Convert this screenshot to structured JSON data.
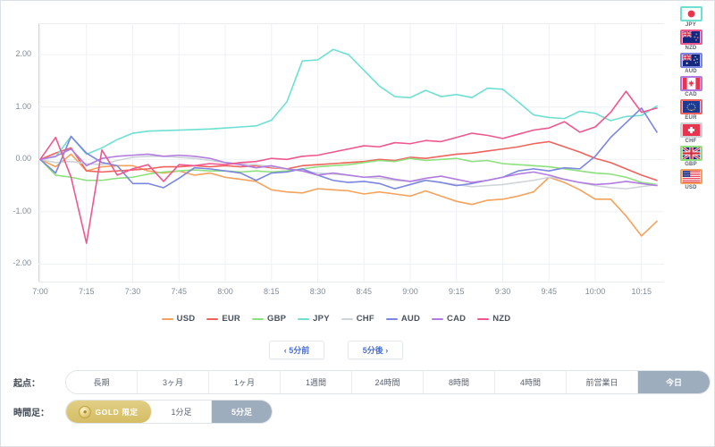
{
  "chart_data": {
    "type": "line",
    "title": "",
    "xlabel": "",
    "ylabel": "",
    "xlim": [
      "7:00",
      "10:20"
    ],
    "ylim": [
      -2.35,
      2.6
    ],
    "yticks": [
      "2.00",
      "1.00",
      "0.00",
      "-1.00",
      "-2.00"
    ],
    "ytick_values": [
      2,
      1,
      0,
      -1,
      -2
    ],
    "xticks": [
      "7:00",
      "7:15",
      "7:30",
      "7:45",
      "8:00",
      "8:15",
      "8:30",
      "8:45",
      "9:00",
      "9:15",
      "9:30",
      "9:45",
      "10:00",
      "10:15"
    ],
    "grid": true,
    "legend_position": "bottom",
    "x": [
      "7:00",
      "7:05",
      "7:10",
      "7:15",
      "7:20",
      "7:25",
      "7:30",
      "7:35",
      "7:40",
      "7:45",
      "7:50",
      "7:55",
      "8:00",
      "8:05",
      "8:10",
      "8:15",
      "8:20",
      "8:25",
      "8:30",
      "8:35",
      "8:40",
      "8:45",
      "8:50",
      "8:55",
      "9:00",
      "9:05",
      "9:10",
      "9:15",
      "9:20",
      "9:25",
      "9:30",
      "9:35",
      "9:40",
      "9:45",
      "9:50",
      "9:55",
      "10:00",
      "10:05",
      "10:10",
      "10:15",
      "10:20"
    ],
    "series": [
      {
        "name": "USD",
        "color": "#f5a35c",
        "values": [
          0.0,
          -0.14,
          0.1,
          -0.22,
          -0.14,
          -0.12,
          -0.12,
          -0.22,
          -0.26,
          -0.22,
          -0.3,
          -0.26,
          -0.34,
          -0.38,
          -0.42,
          -0.58,
          -0.62,
          -0.64,
          -0.56,
          -0.58,
          -0.6,
          -0.66,
          -0.62,
          -0.66,
          -0.7,
          -0.6,
          -0.7,
          -0.8,
          -0.86,
          -0.78,
          -0.76,
          -0.7,
          -0.62,
          -0.34,
          -0.44,
          -0.58,
          -0.76,
          -0.76,
          -1.08,
          -1.46,
          -1.18
        ]
      },
      {
        "name": "EUR",
        "color": "#f0635c",
        "values": [
          0.0,
          0.12,
          0.22,
          -0.22,
          -0.24,
          -0.22,
          -0.2,
          -0.18,
          -0.14,
          -0.14,
          -0.12,
          -0.14,
          -0.12,
          -0.14,
          -0.12,
          -0.16,
          -0.18,
          -0.12,
          -0.1,
          -0.08,
          -0.06,
          -0.04,
          0.0,
          -0.02,
          0.04,
          0.02,
          0.06,
          0.1,
          0.12,
          0.16,
          0.2,
          0.24,
          0.3,
          0.34,
          0.24,
          0.14,
          0.02,
          -0.06,
          -0.18,
          -0.3,
          -0.4
        ]
      },
      {
        "name": "GBP",
        "color": "#8ce07d",
        "values": [
          0.0,
          -0.3,
          -0.34,
          -0.4,
          -0.4,
          -0.36,
          -0.34,
          -0.28,
          -0.24,
          -0.22,
          -0.2,
          -0.22,
          -0.22,
          -0.24,
          -0.22,
          -0.24,
          -0.22,
          -0.18,
          -0.14,
          -0.12,
          -0.1,
          -0.06,
          -0.02,
          -0.04,
          0.02,
          -0.02,
          0.0,
          0.02,
          -0.04,
          -0.02,
          -0.08,
          -0.1,
          -0.12,
          -0.14,
          -0.18,
          -0.22,
          -0.26,
          -0.28,
          -0.34,
          -0.44,
          -0.48
        ]
      },
      {
        "name": "JPY",
        "color": "#6ee0d2",
        "values": [
          0.0,
          0.05,
          0.44,
          0.1,
          0.22,
          0.38,
          0.5,
          0.54,
          0.55,
          0.56,
          0.57,
          0.58,
          0.6,
          0.62,
          0.64,
          0.75,
          1.1,
          1.88,
          1.9,
          2.1,
          2.0,
          1.7,
          1.4,
          1.2,
          1.18,
          1.32,
          1.2,
          1.24,
          1.18,
          1.36,
          1.34,
          1.1,
          0.85,
          0.8,
          0.78,
          0.92,
          0.88,
          0.74,
          0.82,
          0.84,
          1.02
        ]
      },
      {
        "name": "CHF",
        "color": "#cfd4d9",
        "values": [
          0.0,
          -0.06,
          -0.04,
          -0.08,
          -0.1,
          -0.02,
          0.04,
          0.06,
          0.06,
          0.04,
          0.02,
          -0.02,
          -0.06,
          -0.08,
          -0.1,
          -0.14,
          -0.18,
          -0.22,
          -0.26,
          -0.28,
          -0.3,
          -0.34,
          -0.36,
          -0.4,
          -0.42,
          -0.4,
          -0.44,
          -0.48,
          -0.52,
          -0.5,
          -0.48,
          -0.44,
          -0.4,
          -0.34,
          -0.38,
          -0.44,
          -0.5,
          -0.54,
          -0.56,
          -0.52,
          -0.48
        ]
      },
      {
        "name": "AUD",
        "color": "#7b86e0",
        "values": [
          0.0,
          -0.26,
          0.44,
          0.12,
          -0.06,
          -0.12,
          -0.46,
          -0.46,
          -0.54,
          -0.36,
          -0.16,
          -0.18,
          -0.22,
          -0.26,
          -0.4,
          -0.26,
          -0.24,
          -0.18,
          -0.3,
          -0.4,
          -0.44,
          -0.42,
          -0.46,
          -0.56,
          -0.48,
          -0.4,
          -0.44,
          -0.5,
          -0.46,
          -0.4,
          -0.34,
          -0.22,
          -0.18,
          -0.22,
          -0.16,
          -0.18,
          0.06,
          0.42,
          0.7,
          0.98,
          0.52
        ]
      },
      {
        "name": "CAD",
        "color": "#b07ce0",
        "values": [
          0.0,
          0.06,
          0.2,
          -0.12,
          0.02,
          0.06,
          0.08,
          0.1,
          0.06,
          0.08,
          0.06,
          0.02,
          -0.06,
          -0.1,
          -0.16,
          -0.12,
          -0.18,
          -0.22,
          -0.3,
          -0.26,
          -0.3,
          -0.34,
          -0.32,
          -0.38,
          -0.42,
          -0.36,
          -0.32,
          -0.38,
          -0.44,
          -0.4,
          -0.34,
          -0.28,
          -0.24,
          -0.3,
          -0.38,
          -0.44,
          -0.48,
          -0.46,
          -0.42,
          -0.46,
          -0.5
        ]
      },
      {
        "name": "NZD",
        "color": "#f0578f",
        "values": [
          0.0,
          0.42,
          -0.34,
          -1.6,
          0.18,
          -0.3,
          -0.18,
          -0.1,
          -0.42,
          -0.1,
          -0.12,
          -0.08,
          -0.1,
          -0.06,
          -0.04,
          0.02,
          0.0,
          0.06,
          0.08,
          0.14,
          0.2,
          0.26,
          0.24,
          0.32,
          0.3,
          0.36,
          0.34,
          0.42,
          0.5,
          0.46,
          0.4,
          0.48,
          0.56,
          0.6,
          0.72,
          0.52,
          0.62,
          0.9,
          1.3,
          0.9,
          0.98
        ]
      }
    ]
  },
  "legend": {
    "items": [
      {
        "label": "USD",
        "color": "#f5a35c"
      },
      {
        "label": "EUR",
        "color": "#f0635c"
      },
      {
        "label": "GBP",
        "color": "#8ce07d"
      },
      {
        "label": "JPY",
        "color": "#6ee0d2"
      },
      {
        "label": "CHF",
        "color": "#cfd4d9"
      },
      {
        "label": "AUD",
        "color": "#7b86e0"
      },
      {
        "label": "CAD",
        "color": "#b07ce0"
      },
      {
        "label": "NZD",
        "color": "#f0578f"
      }
    ]
  },
  "nav": {
    "prev_label": "‹ 5分前",
    "next_label": "5分後 ›"
  },
  "controls": {
    "origin": {
      "label": "起点：",
      "options": [
        {
          "label": "長期",
          "selected": false
        },
        {
          "label": "3ヶ月",
          "selected": false
        },
        {
          "label": "1ヶ月",
          "selected": false
        },
        {
          "label": "1週間",
          "selected": false
        },
        {
          "label": "24時間",
          "selected": false
        },
        {
          "label": "8時間",
          "selected": false
        },
        {
          "label": "4時間",
          "selected": false
        },
        {
          "label": "前営業日",
          "selected": false
        },
        {
          "label": "今日",
          "selected": true
        }
      ]
    },
    "timeframe": {
      "label": "時間足：",
      "gold_badge": "GOLD 限定",
      "options": [
        {
          "label": "1分足",
          "selected": false
        },
        {
          "label": "5分足",
          "selected": true
        }
      ]
    }
  },
  "flags": {
    "items": [
      {
        "code": "JPY",
        "border": "#6ee0d2"
      },
      {
        "code": "NZD",
        "border": "#f0578f"
      },
      {
        "code": "AUD",
        "border": "#7b86e0"
      },
      {
        "code": "CAD",
        "border": "#b07ce0"
      },
      {
        "code": "EUR",
        "border": "#f0635c"
      },
      {
        "code": "CHF",
        "border": "#cfd4d9"
      },
      {
        "code": "GBP",
        "border": "#8ce07d"
      },
      {
        "code": "USD",
        "border": "#f5a35c"
      }
    ]
  }
}
